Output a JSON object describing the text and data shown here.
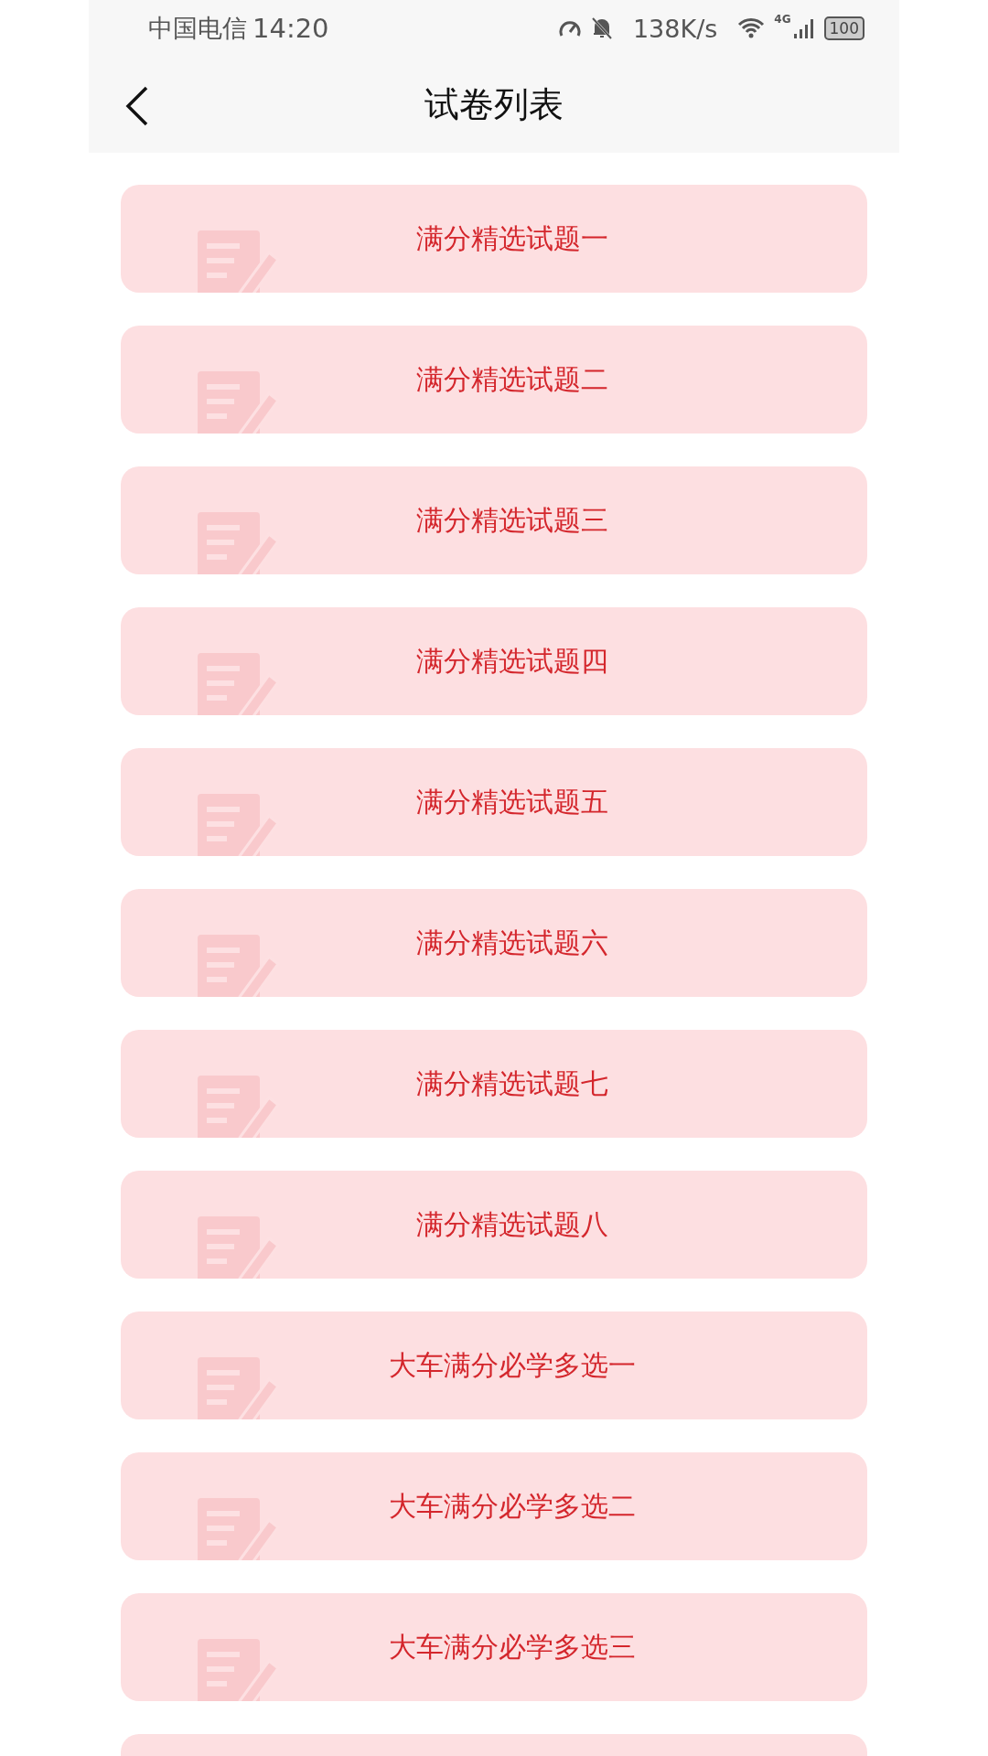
{
  "status_bar": {
    "carrier": "中国电信",
    "time": "14:20",
    "speed": "138K/s",
    "network": "4G",
    "battery": "100"
  },
  "nav": {
    "title": "试卷列表"
  },
  "papers": [
    {
      "title": "满分精选试题一"
    },
    {
      "title": "满分精选试题二"
    },
    {
      "title": "满分精选试题三"
    },
    {
      "title": "满分精选试题四"
    },
    {
      "title": "满分精选试题五"
    },
    {
      "title": "满分精选试题六"
    },
    {
      "title": "满分精选试题七"
    },
    {
      "title": "满分精选试题八"
    },
    {
      "title": "大车满分必学多选一"
    },
    {
      "title": "大车满分必学多选二"
    },
    {
      "title": "大车满分必学多选三"
    }
  ]
}
